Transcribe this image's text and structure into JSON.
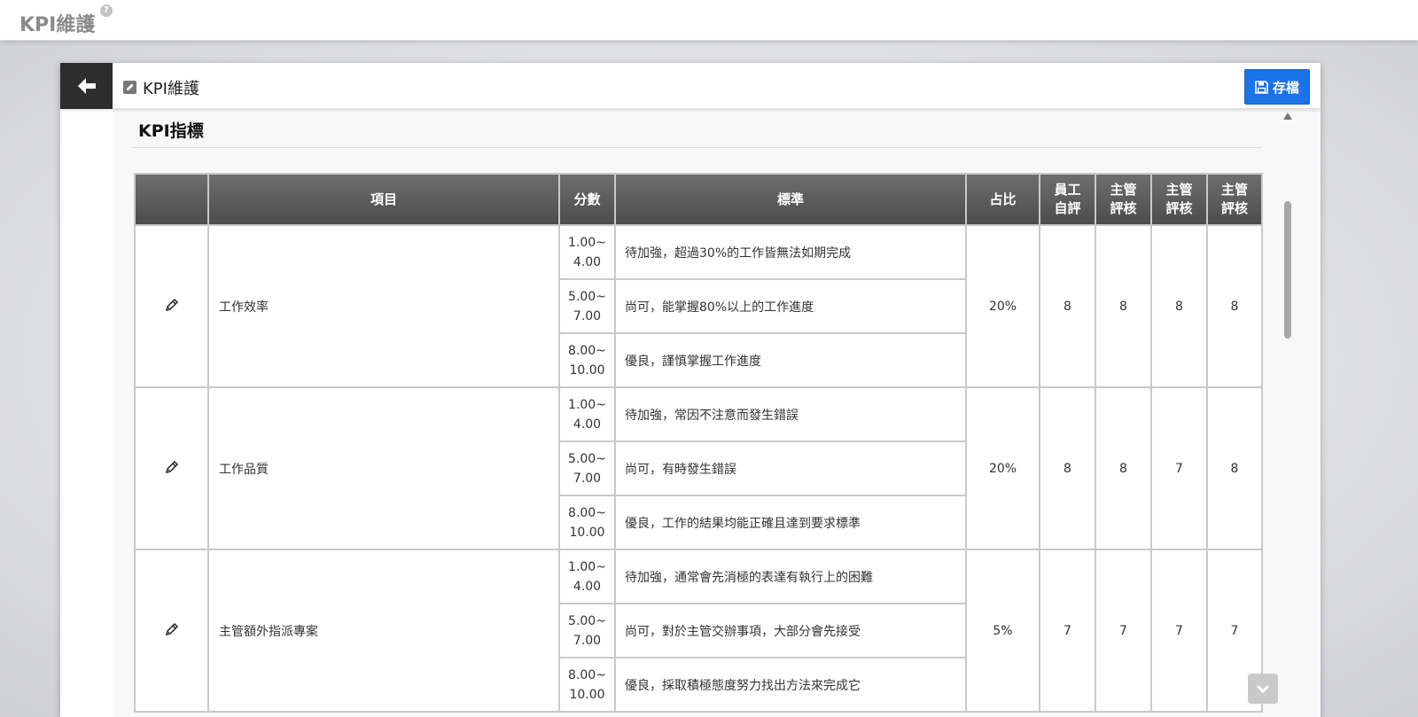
{
  "page": {
    "title": "KPI維護",
    "help": "?"
  },
  "dialog": {
    "title": "KPI維護",
    "save_label": "存檔",
    "section_title": "KPI指標"
  },
  "table": {
    "headers": {
      "item": "項目",
      "score": "分數",
      "standard": "標準",
      "weight": "占比",
      "self_eval": [
        "員工",
        "自評"
      ],
      "mgr1": [
        "主管",
        "評核"
      ],
      "mgr2": [
        "主管",
        "評核"
      ],
      "mgr3": [
        "主管",
        "評核"
      ]
    },
    "rows": [
      {
        "item": "工作效率",
        "weight": "20%",
        "self": "8",
        "mgr1": "8",
        "mgr2": "8",
        "mgr3": "8",
        "levels": [
          {
            "score": [
              "1.00~",
              "4.00"
            ],
            "standard": "待加強，超過30%的工作皆無法如期完成"
          },
          {
            "score": [
              "5.00~",
              "7.00"
            ],
            "standard": "尚可，能掌握80%以上的工作進度"
          },
          {
            "score": [
              "8.00~",
              "10.00"
            ],
            "standard": "優良，謹慎掌握工作進度"
          }
        ]
      },
      {
        "item": "工作品質",
        "weight": "20%",
        "self": "8",
        "mgr1": "8",
        "mgr2": "7",
        "mgr3": "8",
        "levels": [
          {
            "score": [
              "1.00~",
              "4.00"
            ],
            "standard": "待加強，常因不注意而發生錯誤"
          },
          {
            "score": [
              "5.00~",
              "7.00"
            ],
            "standard": "尚可，有時發生錯誤"
          },
          {
            "score": [
              "8.00~",
              "10.00"
            ],
            "standard": "優良，工作的結果均能正確且達到要求標準"
          }
        ]
      },
      {
        "item": "主管額外指派專案",
        "weight": "5%",
        "self": "7",
        "mgr1": "7",
        "mgr2": "7",
        "mgr3": "7",
        "levels": [
          {
            "score": [
              "1.00~",
              "4.00"
            ],
            "standard": "待加強，通常會先消極的表達有執行上的困難"
          },
          {
            "score": [
              "5.00~",
              "7.00"
            ],
            "standard": "尚可，對於主管交辦事項，大部分會先接受"
          },
          {
            "score": [
              "8.00~",
              "10.00"
            ],
            "standard": "優良，採取積極態度努力找出方法來完成它"
          }
        ]
      }
    ]
  },
  "colors": {
    "save": "#1a73e8",
    "header": "#5a5a5a",
    "back": "#2d2d2d"
  }
}
